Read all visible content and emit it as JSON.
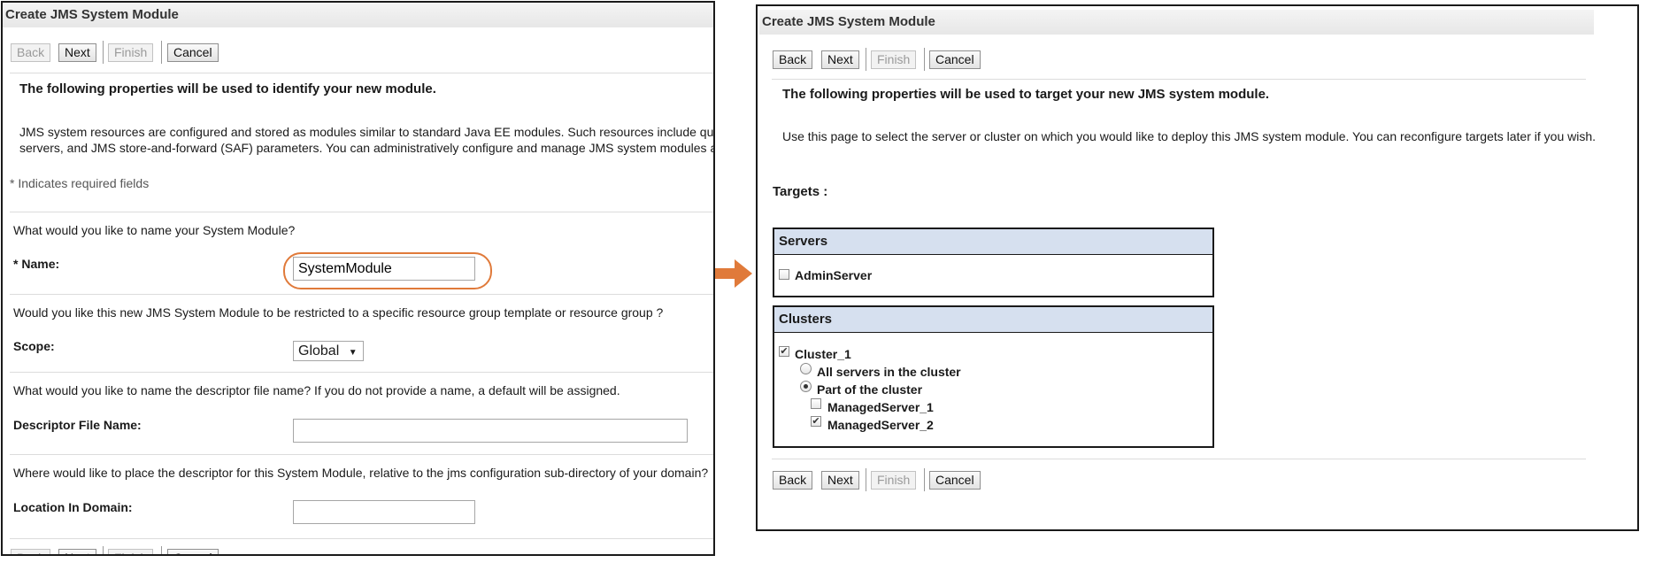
{
  "left": {
    "title": "Create JMS System Module",
    "buttons": {
      "back": "Back",
      "next": "Next",
      "finish": "Finish",
      "cancel": "Cancel"
    },
    "heading": "The following properties will be used to identify your new module.",
    "desc_line1": "JMS system resources are configured and stored as modules similar to standard Java EE modules. Such resources include queues",
    "desc_line2": "servers, and JMS store-and-forward (SAF) parameters. You can administratively configure and manage JMS system modules as g",
    "required_note": "* Indicates required fields",
    "q_name": "What would you like to name your System Module?",
    "name_label": "Name:",
    "name_asterisk": "*",
    "name_value": "SystemModule",
    "q_scope": "Would you like this new JMS System Module to be restricted to a specific resource group template or resource group ?",
    "scope_label": "Scope:",
    "scope_value": "Global",
    "q_descriptor": "What would you like to name the descriptor file name? If you do not provide a name, a default will be assigned.",
    "descriptor_label": "Descriptor File Name:",
    "descriptor_value": "",
    "q_location": "Where would like to place the descriptor for this System Module, relative to the jms configuration sub-directory of your domain?",
    "location_label": "Location In Domain:",
    "location_value": ""
  },
  "arrow_icon": "right-arrow-icon",
  "accent_color": "#e07a3a",
  "right": {
    "title": "Create JMS System Module",
    "buttons": {
      "back": "Back",
      "next": "Next",
      "finish": "Finish",
      "cancel": "Cancel"
    },
    "heading": "The following properties will be used to target your new JMS system module.",
    "desc": "Use this page to select the server or cluster on which you would like to deploy this JMS system module. You can reconfigure targets later if you wish.",
    "targets_label": "Targets :",
    "servers": {
      "header": "Servers",
      "items": [
        {
          "label": "AdminServer",
          "checked": false
        }
      ]
    },
    "clusters": {
      "header": "Clusters",
      "cluster_name": "Cluster_1",
      "cluster_checked": true,
      "option_all": "All servers in the cluster",
      "option_part": "Part of the cluster",
      "selected_option": "part",
      "members": [
        {
          "label": "ManagedServer_1",
          "checked": false
        },
        {
          "label": "ManagedServer_2",
          "checked": true
        }
      ]
    }
  }
}
